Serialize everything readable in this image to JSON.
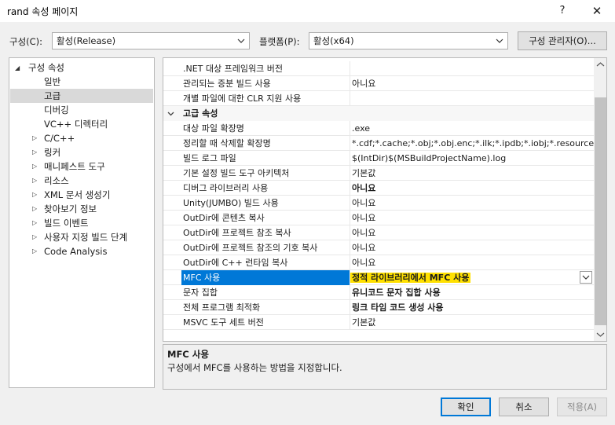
{
  "window": {
    "title": "rand 속성 페이지",
    "help": "?",
    "close": "✕"
  },
  "toolbar": {
    "config_label": "구성(C):",
    "config_value": "활성(Release)",
    "platform_label": "플랫폼(P):",
    "platform_value": "활성(x64)",
    "config_manager": "구성 관리자(O)..."
  },
  "tree": {
    "root": "구성 속성",
    "items": [
      {
        "label": "일반",
        "expandable": false
      },
      {
        "label": "고급",
        "expandable": false,
        "selected": true
      },
      {
        "label": "디버깅",
        "expandable": false
      },
      {
        "label": "VC++ 디렉터리",
        "expandable": false
      },
      {
        "label": "C/C++",
        "expandable": true
      },
      {
        "label": "링커",
        "expandable": true
      },
      {
        "label": "매니페스트 도구",
        "expandable": true
      },
      {
        "label": "리소스",
        "expandable": true
      },
      {
        "label": "XML 문서 생성기",
        "expandable": true
      },
      {
        "label": "찾아보기 정보",
        "expandable": true
      },
      {
        "label": "빌드 이벤트",
        "expandable": true
      },
      {
        "label": "사용자 지정 빌드 단계",
        "expandable": true
      },
      {
        "label": "Code Analysis",
        "expandable": true
      }
    ]
  },
  "grid": {
    "rows_top": [
      {
        "name": ".NET 대상 프레임워크 버전",
        "value": "",
        "bold": false
      },
      {
        "name": "관리되는 증분 빌드 사용",
        "value": "아니요",
        "bold": false
      },
      {
        "name": "개별 파일에 대한 CLR 지원 사용",
        "value": "",
        "bold": false
      }
    ],
    "category": "고급 속성",
    "rows": [
      {
        "name": "대상 파일 확장명",
        "value": ".exe",
        "bold": false
      },
      {
        "name": "정리할 때 삭제할 확장명",
        "value": "*.cdf;*.cache;*.obj;*.obj.enc;*.ilk;*.ipdb;*.iobj;*.resources;*.t",
        "bold": false
      },
      {
        "name": "빌드 로그 파일",
        "value": "$(IntDir)$(MSBuildProjectName).log",
        "bold": false
      },
      {
        "name": "기본 설정 빌드 도구 아키텍처",
        "value": "기본값",
        "bold": false
      },
      {
        "name": "디버그 라이브러리 사용",
        "value": "아니요",
        "bold": true
      },
      {
        "name": "Unity(JUMBO) 빌드 사용",
        "value": "아니요",
        "bold": false
      },
      {
        "name": "OutDir에 콘텐츠 복사",
        "value": "아니요",
        "bold": false
      },
      {
        "name": "OutDir에 프로젝트 참조 복사",
        "value": "아니요",
        "bold": false
      },
      {
        "name": "OutDir에 프로젝트 참조의 기호 복사",
        "value": "아니요",
        "bold": false
      },
      {
        "name": "OutDir에 C++ 런타임 복사",
        "value": "아니요",
        "bold": false
      },
      {
        "name": "MFC 사용",
        "value": "정적 라이브러리에서 MFC 사용",
        "bold": true,
        "selected": true
      },
      {
        "name": "문자 집합",
        "value": "유니코드 문자 집합 사용",
        "bold": true
      },
      {
        "name": "전체 프로그램 최적화",
        "value": "링크 타임 코드 생성 사용",
        "bold": true
      },
      {
        "name": "MSVC 도구 세트 버전",
        "value": "기본값",
        "bold": false
      }
    ]
  },
  "description": {
    "title": "MFC 사용",
    "text": "구성에서 MFC를 사용하는 방법을 지정합니다."
  },
  "buttons": {
    "ok": "확인",
    "cancel": "취소",
    "apply": "적용(A)"
  },
  "colors": {
    "selection": "#0078d7",
    "highlight": "#ffe000",
    "tree_selection": "#d9d9d9"
  }
}
